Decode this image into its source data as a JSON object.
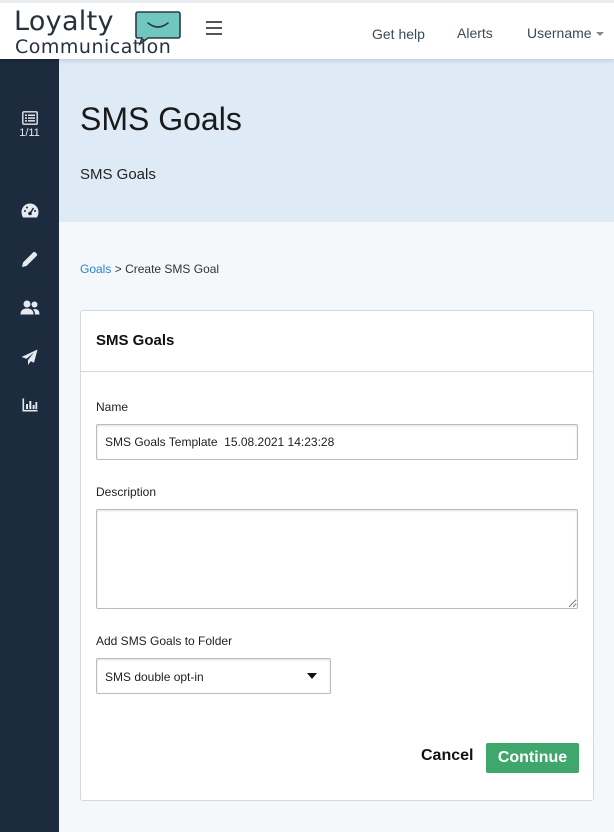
{
  "brand": {
    "line1": "Loyalty",
    "line2": "Communication",
    "accent_color": "#6fc7c0"
  },
  "topnav": {
    "help": "Get help",
    "alerts": "Alerts",
    "user": "Username"
  },
  "sidebar": {
    "items": [
      {
        "icon": "list-icon",
        "count": "1/11"
      },
      {
        "icon": "dashboard-icon"
      },
      {
        "icon": "pencil-icon"
      },
      {
        "icon": "users-icon"
      },
      {
        "icon": "paper-plane-icon"
      },
      {
        "icon": "bar-chart-icon"
      }
    ],
    "bg_color": "#1c2b3e"
  },
  "header": {
    "title": "SMS Goals",
    "subtitle": "SMS Goals"
  },
  "breadcrumb": {
    "parent": "Goals",
    "separator": ">",
    "current": "Create SMS Goal"
  },
  "form": {
    "card_title": "SMS Goals",
    "name_label": "Name",
    "name_value": "SMS Goals Template  15.08.2021 14:23:28",
    "description_label": "Description",
    "description_value": "",
    "folder_label": "Add SMS Goals to Folder",
    "folder_value": "SMS double opt-in",
    "cancel_label": "Cancel",
    "continue_label": "Continue",
    "continue_color": "#3fa76c"
  }
}
